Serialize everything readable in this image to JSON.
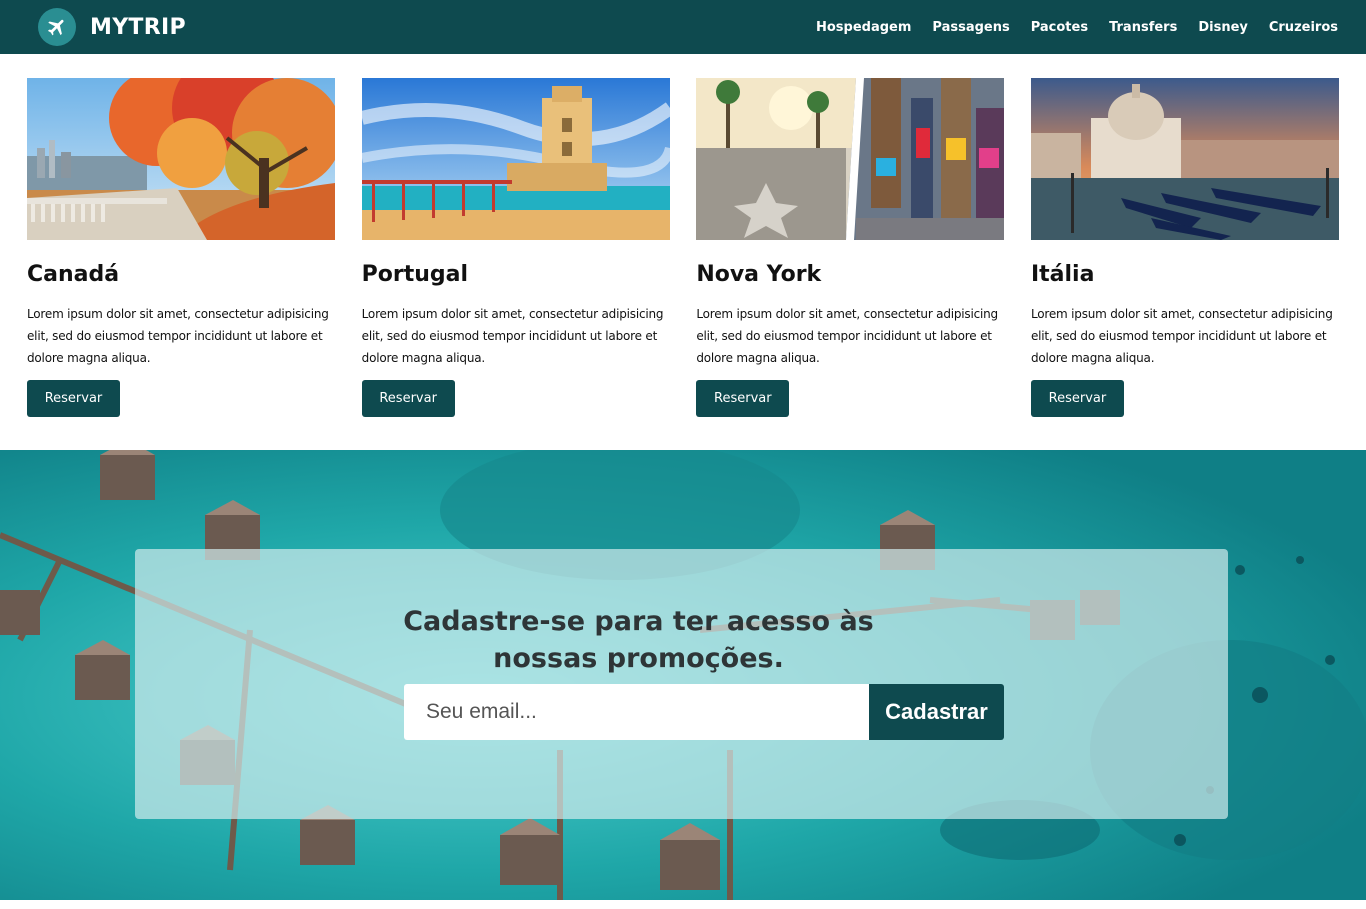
{
  "header": {
    "brand": "MYTRIP",
    "logo_icon": "airplane-icon",
    "nav": [
      "Hospedagem",
      "Passagens",
      "Pacotes",
      "Transfers",
      "Disney",
      "Cruzeiros"
    ]
  },
  "cards": [
    {
      "title": "Canadá",
      "text": "Lorem ipsum dolor sit amet, consectetur adipisicing elit, sed do eiusmod tempor incididunt ut labore et dolore magna aliqua.",
      "button": "Reservar"
    },
    {
      "title": "Portugal",
      "text": "Lorem ipsum dolor sit amet, consectetur adipisicing elit, sed do eiusmod tempor incididunt ut labore et dolore magna aliqua.",
      "button": "Reservar"
    },
    {
      "title": "Nova York",
      "text": "Lorem ipsum dolor sit amet, consectetur adipisicing elit, sed do eiusmod tempor incididunt ut labore et dolore magna aliqua.",
      "button": "Reservar"
    },
    {
      "title": "Itália",
      "text": "Lorem ipsum dolor sit amet, consectetur adipisicing elit, sed do eiusmod tempor incididunt ut labore et dolore magna aliqua.",
      "button": "Reservar"
    }
  ],
  "newsletter": {
    "title": "Cadastre-se para ter acesso às nossas promoções.",
    "email_placeholder": "Seu email...",
    "submit_label": "Cadastrar"
  },
  "colors": {
    "primary": "#0e4a4f",
    "logo_circle": "#2a8e92",
    "sea": "#1fa7a8"
  }
}
